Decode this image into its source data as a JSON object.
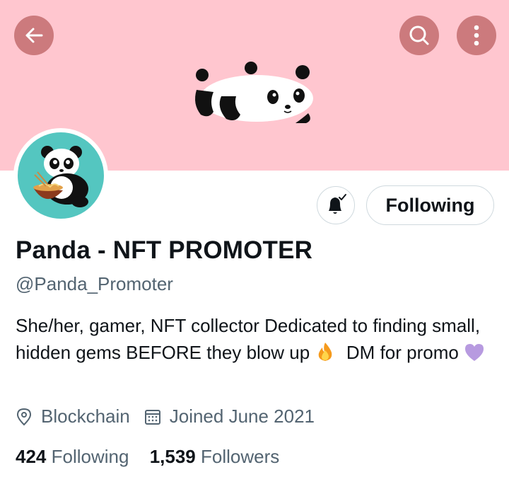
{
  "profile": {
    "name": "Panda - NFT PROMOTER",
    "handle": "@Panda_Promoter",
    "bio_text_1": "She/her, gamer, NFT collector Dedicated to finding small, hidden gems BEFORE they blow up",
    "bio_text_2": "DM for promo",
    "location": "Blockchain",
    "joined": "Joined June 2021",
    "following_count": "424",
    "following_label": "Following",
    "followers_count": "1,539",
    "followers_label": "Followers"
  },
  "actions": {
    "follow_button_label": "Following"
  },
  "icons": {
    "back": "arrow-left-icon",
    "search": "search-icon",
    "more": "more-vertical-icon",
    "notifications": "bell-check-icon",
    "location": "location-pin-icon",
    "calendar": "calendar-icon",
    "bio_emoji_1": "fire-emoji",
    "bio_emoji_2": "purple-heart-emoji"
  },
  "colors": {
    "banner": "#ffc6cf",
    "header_buttons": "#cc7a7d",
    "avatar_bg": "#54c6c0",
    "secondary_text": "#536471",
    "border": "#cfd9de"
  }
}
